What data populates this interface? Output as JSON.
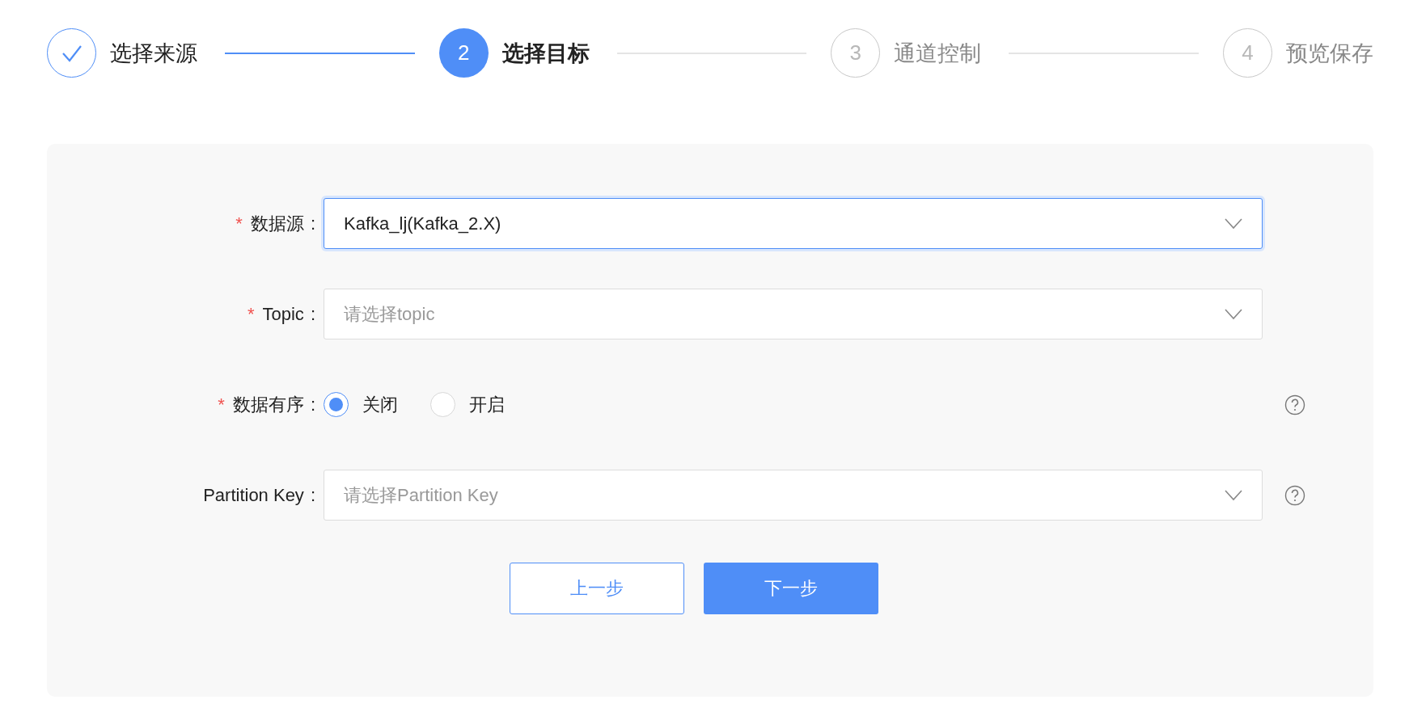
{
  "steps": [
    {
      "title": "选择来源",
      "done": true,
      "selected": false
    },
    {
      "number": "2",
      "title": "选择目标",
      "done": false,
      "selected": true
    },
    {
      "number": "3",
      "title": "通道控制",
      "done": false,
      "selected": false
    },
    {
      "number": "4",
      "title": "预览保存",
      "done": false,
      "selected": false
    }
  ],
  "form": {
    "fields": [
      {
        "kind": "select",
        "required_mark": "*",
        "label": "数据源",
        "colon": ":",
        "value": "Kafka_lj(Kafka_2.X)",
        "focused": true,
        "help": false
      },
      {
        "kind": "select",
        "required_mark": "*",
        "label": "Topic",
        "colon": ":",
        "placeholder": "请选择topic",
        "focused": false,
        "help": false
      },
      {
        "kind": "radio",
        "required_mark": "*",
        "label": "数据有序",
        "colon": ":",
        "help": true,
        "options": [
          {
            "label": "关闭",
            "selected": true
          },
          {
            "label": "开启",
            "selected": false
          }
        ]
      },
      {
        "kind": "select",
        "label": "Partition Key",
        "colon": ":",
        "placeholder": "请选择Partition Key",
        "focused": false,
        "help": true
      }
    ],
    "buttons": [
      {
        "label": "上一步",
        "kind": "secondary"
      },
      {
        "label": "下一步",
        "kind": "primary"
      }
    ]
  }
}
